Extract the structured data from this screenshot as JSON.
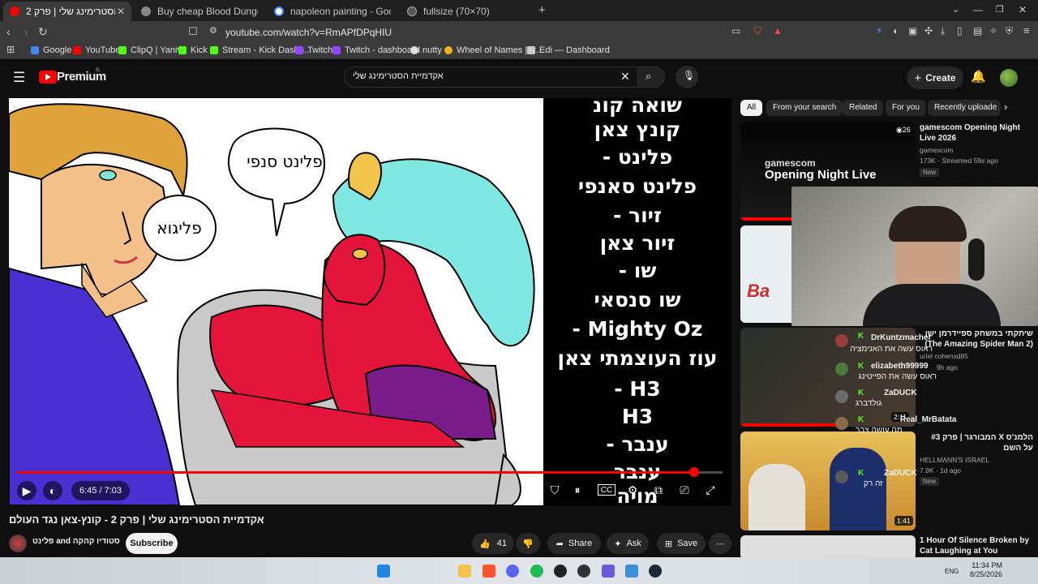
{
  "browser": {
    "tabs": [
      {
        "label": "2 אקדמיית הסטרימינג שלי | פרק",
        "active": true,
        "color": "#ff0000"
      },
      {
        "label": "Buy cheap Blood Dungeon CD Key",
        "active": false,
        "color": "#888888"
      },
      {
        "label": "napoleon painting - Google Search",
        "active": false,
        "color": "#4285f4"
      },
      {
        "label": "fullsize (70×70)",
        "active": false,
        "color": "#aaaaaa"
      }
    ],
    "new_tab": "+",
    "url": "youtube.com/watch?v=RmAPfDPqHIU",
    "bookmarks": [
      {
        "label": "Google",
        "color": "#4285f4"
      },
      {
        "label": "YouTube",
        "color": "#ff0000"
      },
      {
        "label": "ClipQ | Yanivu",
        "color": "#53fc18"
      },
      {
        "label": "Kick",
        "color": "#53fc18"
      },
      {
        "label": "Stream - Kick Dashb...",
        "color": "#53fc18"
      },
      {
        "label": "Twitch",
        "color": "#9146ff"
      },
      {
        "label": "Twitch - dashboard",
        "color": "#9146ff"
      },
      {
        "label": "nutty",
        "color": "#dddddd"
      },
      {
        "label": "Wheel of Names | R...",
        "color": "#f2b01e"
      },
      {
        "label": "Edi — Dashboard",
        "color": "#cccccc"
      }
    ]
  },
  "yt": {
    "logo": "Premium",
    "logo_region": "IL",
    "search_value": "אקדמיית הסטרימינג שלי",
    "create": "Create"
  },
  "video": {
    "speech_left": "פליגוא",
    "speech_right": "פלינט סנפי",
    "credits": [
      "שואה קונ",
      "קונץ צאן",
      "- פלינט",
      "פלינט סאנפי",
      "- זיור",
      "זיור צאן",
      "- שו",
      "שו סנסאי",
      "- Mighty Oz",
      "עוז העוצמתי צאן",
      "- H3",
      "H3",
      "- ענבר",
      "ענבר",
      "מויה"
    ],
    "time": "6:45 / 7:03",
    "progress": 0.96
  },
  "below": {
    "title": "אקדמיית הסטרימינג שלי | פרק 2 - קונץ-צאן נגד העולם",
    "channel": "פלינט and סטודיו קהקה",
    "subscribe": "Subscribe",
    "likes": "41",
    "share": "Share",
    "ask": "Ask",
    "save": "Save"
  },
  "chips": [
    "All",
    "From your search",
    "Related",
    "For you",
    "Recently uploade"
  ],
  "recos": [
    {
      "title": "gamescom Opening Night Live 2026",
      "channel": "gamescom",
      "meta": "173K · Streamed 59s ago",
      "badge": "New",
      "thumb_text": "Opening Night Live",
      "thumb_small": "gamescom"
    },
    {
      "title": "שיתקתי במשחק ספיידרמן ישן (The Amazing Spider Man 2)",
      "channel": "uriel cohenxd85",
      "meta": "9h ago",
      "dur": "2:11"
    },
    {
      "title": "הלמנ'ס X המבורגר | פרק #3 על השם",
      "channel": "HELLMANN'S ISRAEL",
      "meta": "7.9K · 1d ago",
      "badge": "New",
      "dur": "1:41"
    },
    {
      "title": "1 Hour Of Silence Broken by Cat Laughing at You",
      "channel": "",
      "meta": ""
    }
  ],
  "chat": [
    {
      "user": "DrKuntzmacher",
      "msg": "ראוס עשה את האנימציה",
      "color": "#ff3b3b"
    },
    {
      "user": "elizabeth99999",
      "msg": "ראוס עשה את הפייטינג",
      "color": "#ff4fd8"
    },
    {
      "user": "ZaDUCK",
      "msg": "גולדברג",
      "color": "#f2e600"
    },
    {
      "user": "Real_MrBatata",
      "msg": "מה עושה צבר",
      "color": "#ff3b3b"
    },
    {
      "user": "ZaDUCK",
      "msg": "זה רק",
      "color": "#f2e600"
    }
  ],
  "taskbar": {
    "time": "11:34 PM",
    "date": "8/25/2026",
    "lang": "ENG"
  }
}
